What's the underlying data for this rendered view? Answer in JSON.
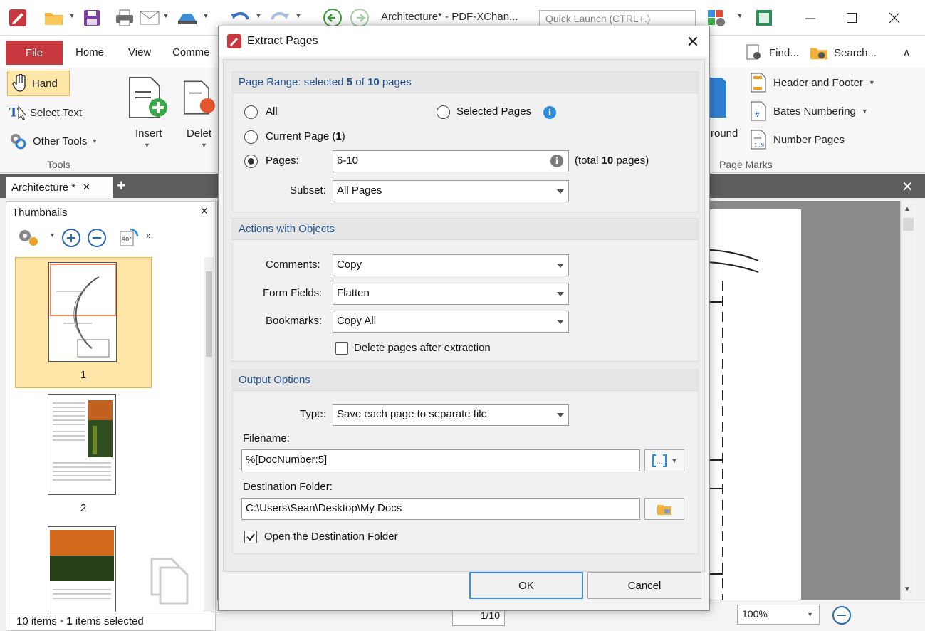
{
  "window": {
    "title": "Architecture* - PDF-XChan...",
    "quick_launch_placeholder": "Quick Launch (CTRL+.)"
  },
  "ribbon": {
    "tabs": [
      "File",
      "Home",
      "View",
      "Comme"
    ],
    "find_label": "Find...",
    "search_label": "Search...",
    "tools": {
      "hand": "Hand",
      "select_text": "Select Text",
      "other_tools": "Other Tools",
      "group_label": "Tools"
    },
    "insert_label": "Insert",
    "delete_label": "Delet",
    "background_label": "round",
    "page_marks": {
      "header_footer": "Header and Footer",
      "bates_numbering": "Bates Numbering",
      "number_pages": "Number Pages",
      "group_label": "Page Marks"
    }
  },
  "doc_tab": {
    "label": "Architecture *"
  },
  "thumbnails": {
    "title": "Thumbnails",
    "items": [
      {
        "label": "1"
      },
      {
        "label": "2"
      }
    ],
    "status_count": "10 items",
    "status_sep": "•",
    "status_selected_count": "1",
    "status_selected_text": "items selected"
  },
  "bottom_bar": {
    "page_indicator": "1/10",
    "zoom": "100%"
  },
  "dialog": {
    "title": "Extract Pages",
    "page_range": {
      "heading_prefix": "Page Range: selected",
      "selected": "5",
      "heading_of": "of",
      "total": "10",
      "heading_suffix": "pages",
      "all_label": "All",
      "selected_pages_label": "Selected Pages",
      "current_page_label": "Current Page",
      "current_page_num": "1",
      "pages_label": "Pages:",
      "pages_value": "6-10",
      "total_prefix": "(total",
      "total_pages": "10",
      "total_suffix": "pages)",
      "subset_label": "Subset:",
      "subset_value": "All Pages",
      "selected_option": "Pages"
    },
    "actions": {
      "heading": "Actions with Objects",
      "comments_label": "Comments:",
      "comments_value": "Copy",
      "form_fields_label": "Form Fields:",
      "form_fields_value": "Flatten",
      "bookmarks_label": "Bookmarks:",
      "bookmarks_value": "Copy All",
      "delete_after_label": "Delete pages after extraction",
      "delete_after_checked": false
    },
    "output": {
      "heading": "Output Options",
      "type_label": "Type:",
      "type_value": "Save each page to separate file",
      "filename_label": "Filename:",
      "filename_value": "%[DocNumber:5]",
      "dest_label": "Destination Folder:",
      "dest_value": "C:\\Users\\Sean\\Desktop\\My Docs",
      "open_dest_label": "Open the Destination Folder",
      "open_dest_checked": true
    },
    "ok_label": "OK",
    "cancel_label": "Cancel"
  },
  "colors": {
    "file_tab": "#c8393f",
    "section_heading": "#1f4f8a",
    "default_button_border": "#3a8ee6",
    "info_icon": "#2b8ce0",
    "thumb_selected": "#fde6a8"
  }
}
